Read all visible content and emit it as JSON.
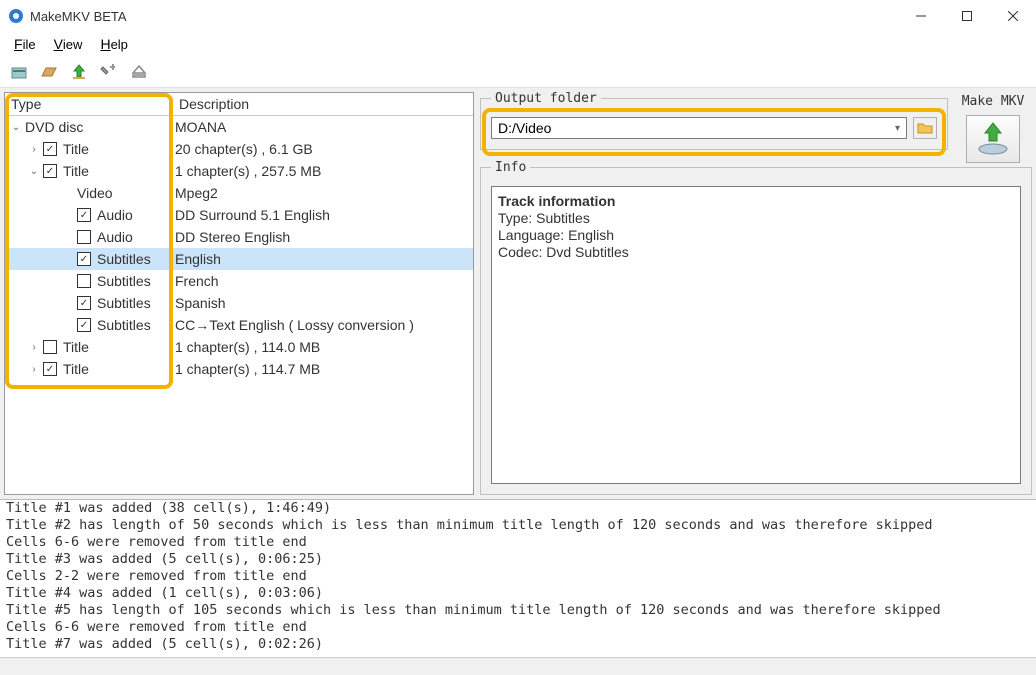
{
  "window": {
    "title": "MakeMKV BETA"
  },
  "menu": {
    "file": "File",
    "view": "View",
    "help": "Help"
  },
  "tree": {
    "cols": {
      "type": "Type",
      "desc": "Description"
    },
    "rows": [
      {
        "indent": 0,
        "exp": "open",
        "cb": null,
        "type": "DVD disc",
        "desc": "MOANA",
        "sel": false
      },
      {
        "indent": 1,
        "exp": "closed",
        "cb": "on",
        "type": "Title",
        "desc": "20 chapter(s) , 6.1 GB",
        "sel": false
      },
      {
        "indent": 1,
        "exp": "open",
        "cb": "on",
        "type": "Title",
        "desc": "1 chapter(s) , 257.5 MB",
        "sel": false
      },
      {
        "indent": 2,
        "exp": null,
        "cb": null,
        "type": "Video",
        "desc": "Mpeg2",
        "sel": false
      },
      {
        "indent": 2,
        "exp": null,
        "cb": "on",
        "type": "Audio",
        "desc": "DD Surround 5.1 English",
        "sel": false
      },
      {
        "indent": 2,
        "exp": null,
        "cb": "off",
        "type": "Audio",
        "desc": "DD Stereo English",
        "sel": false
      },
      {
        "indent": 2,
        "exp": null,
        "cb": "on",
        "type": "Subtitles",
        "desc": "English",
        "sel": true
      },
      {
        "indent": 2,
        "exp": null,
        "cb": "off",
        "type": "Subtitles",
        "desc": "French",
        "sel": false
      },
      {
        "indent": 2,
        "exp": null,
        "cb": "on",
        "type": "Subtitles",
        "desc": "Spanish",
        "sel": false
      },
      {
        "indent": 2,
        "exp": null,
        "cb": "on",
        "type": "Subtitles",
        "desc": "CC→Text English ( Lossy conversion )",
        "sel": false
      },
      {
        "indent": 1,
        "exp": "closed",
        "cb": "off",
        "type": "Title",
        "desc": "1 chapter(s) , 114.0 MB",
        "sel": false
      },
      {
        "indent": 1,
        "exp": "closed",
        "cb": "on",
        "type": "Title",
        "desc": "1 chapter(s) , 114.7 MB",
        "sel": false
      }
    ]
  },
  "output": {
    "group_label": "Output folder",
    "value": "D:/Video"
  },
  "make_mkv": {
    "label": "Make MKV"
  },
  "info": {
    "group_label": "Info",
    "heading": "Track information",
    "lines": {
      "type": "Type: Subtitles",
      "lang": "Language: English",
      "codec": "Codec: Dvd Subtitles"
    }
  },
  "log": [
    "Title #1 was added (38 cell(s), 1:46:49)",
    "Title #2 has length of 50 seconds which is less than minimum title length of 120 seconds and was therefore skipped",
    "Cells 6-6 were removed from title end",
    "Title #3 was added (5 cell(s), 0:06:25)",
    "Cells 2-2 were removed from title end",
    "Title #4 was added (1 cell(s), 0:03:06)",
    "Title #5 has length of 105 seconds which is less than minimum title length of 120 seconds and was therefore skipped",
    "Cells 6-6 were removed from title end",
    "Title #7 was added (5 cell(s), 0:02:26)"
  ]
}
